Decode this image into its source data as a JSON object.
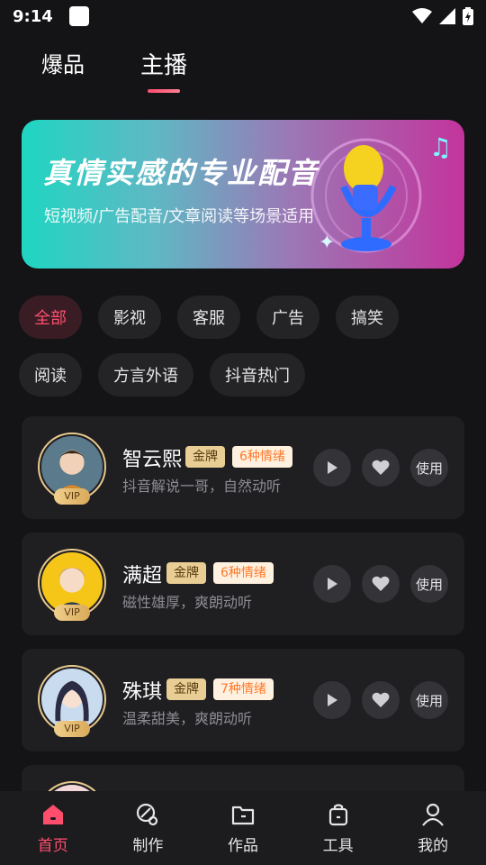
{
  "status": {
    "time": "9:14"
  },
  "top_tabs": [
    {
      "label": "爆品"
    },
    {
      "label": "主播"
    }
  ],
  "banner": {
    "title": "真情实感的专业配音",
    "subtitle": "短视频/广告配音/文章阅读等场景适用"
  },
  "categories": [
    "全部",
    "影视",
    "客服",
    "广告",
    "搞笑",
    "阅读",
    "方言外语",
    "抖音热门"
  ],
  "voices": [
    {
      "name": "智云熙",
      "tag": "金牌",
      "emotions": "6种情绪",
      "desc": "抖音解说一哥，自然动听",
      "vip": "VIP",
      "use": "使用"
    },
    {
      "name": "满超",
      "tag": "金牌",
      "emotions": "6种情绪",
      "desc": "磁性雄厚，爽朗动听",
      "vip": "VIP",
      "use": "使用"
    },
    {
      "name": "殊琪",
      "tag": "金牌",
      "emotions": "7种情绪",
      "desc": "温柔甜美，爽朗动听",
      "vip": "VIP",
      "use": "使用"
    }
  ],
  "bottom_nav": [
    {
      "label": "首页",
      "icon": "home-icon"
    },
    {
      "label": "制作",
      "icon": "create-icon"
    },
    {
      "label": "作品",
      "icon": "folder-icon"
    },
    {
      "label": "工具",
      "icon": "toolbox-icon"
    },
    {
      "label": "我的",
      "icon": "profile-icon"
    }
  ],
  "colors": {
    "accent": "#ff4d6d",
    "background": "#141416",
    "card": "#1f1f22",
    "gold": "#e8cd94",
    "emotion": "#ff7a2e"
  }
}
